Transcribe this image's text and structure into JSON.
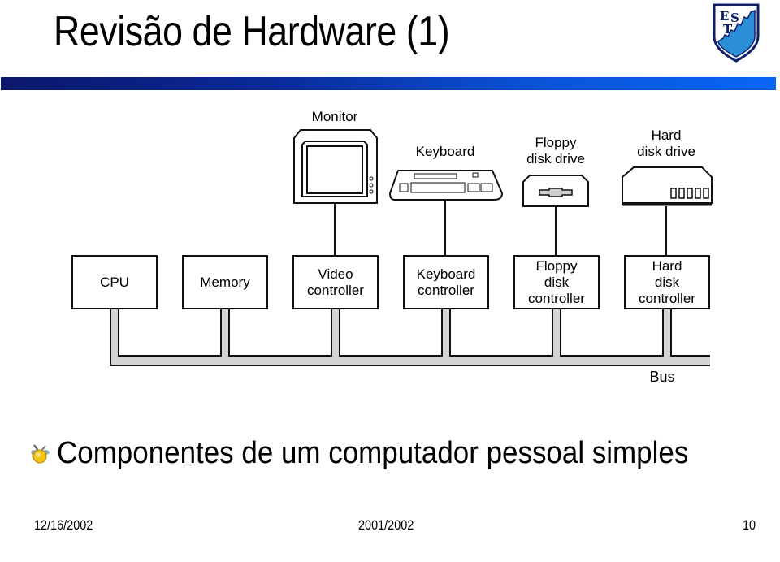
{
  "slide": {
    "title": "Revisão de Hardware (1)",
    "logo": {
      "icon": "est-shield-logo",
      "letters": [
        "E",
        "S",
        "T"
      ],
      "colors": {
        "navy": "#0b1f6e",
        "blue": "#2b8fd8"
      }
    },
    "accent_bar_colors": [
      "#0b176a",
      "#0866f4"
    ]
  },
  "diagram": {
    "devices": [
      {
        "id": "monitor",
        "label": "Monitor"
      },
      {
        "id": "keyboard",
        "label": "Keyboard"
      },
      {
        "id": "floppy-drive",
        "label_lines": [
          "Floppy",
          "disk drive"
        ]
      },
      {
        "id": "hard-drive",
        "label_lines": [
          "Hard",
          "disk drive"
        ]
      }
    ],
    "components": [
      {
        "id": "cpu",
        "label_lines": [
          "CPU"
        ]
      },
      {
        "id": "memory",
        "label_lines": [
          "Memory"
        ]
      },
      {
        "id": "video-controller",
        "label_lines": [
          "Video",
          "controller"
        ]
      },
      {
        "id": "keyboard-controller",
        "label_lines": [
          "Keyboard",
          "controller"
        ]
      },
      {
        "id": "floppy-controller",
        "label_lines": [
          "Floppy",
          "disk",
          "controller"
        ]
      },
      {
        "id": "hard-disk-controller",
        "label_lines": [
          "Hard",
          "disk",
          "controller"
        ]
      }
    ],
    "bus_label": "Bus",
    "bus_fill": "#d4d4d4"
  },
  "caption": {
    "bullet_icon": "bee-bullet-icon",
    "text": "Componentes de um computador pessoal simples"
  },
  "footer": {
    "date": "12/16/2002",
    "center": "2001/2002",
    "page": "10"
  }
}
